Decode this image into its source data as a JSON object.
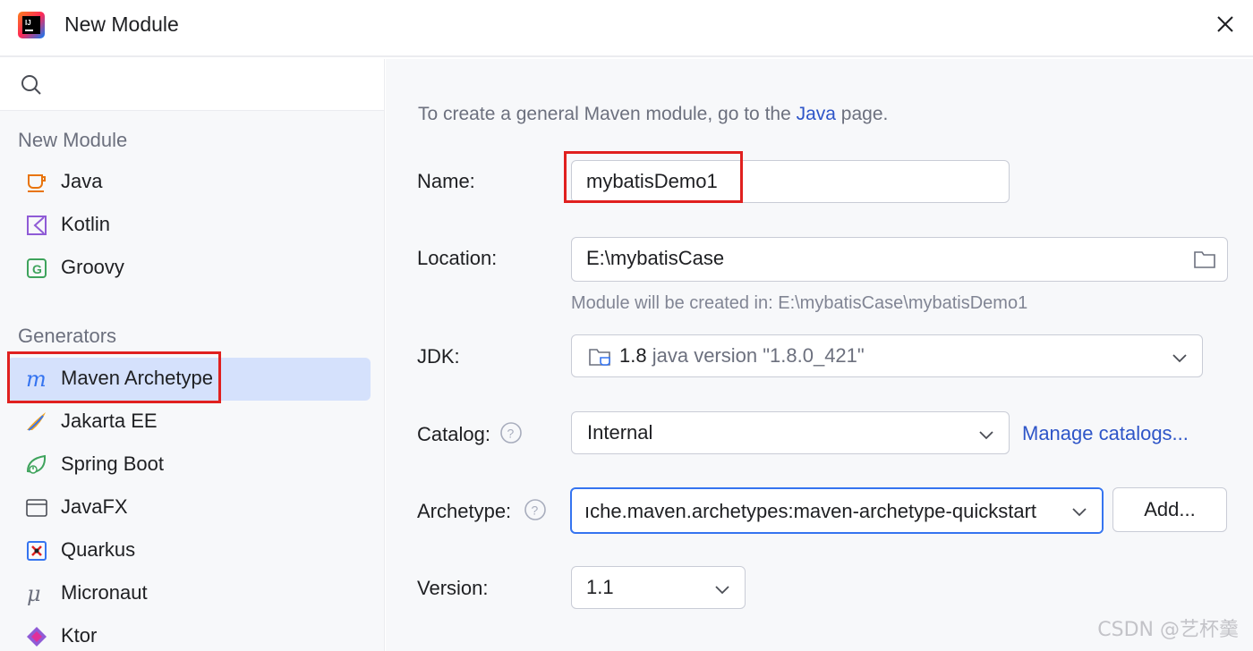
{
  "window": {
    "title": "New Module",
    "logo_icon": "intellij-logo-icon",
    "close_icon": "close-icon"
  },
  "sidebar": {
    "search_icon": "search-icon",
    "sections": [
      {
        "header": "New Module",
        "items": [
          {
            "label": "Java",
            "icon": "java-cup-icon"
          },
          {
            "label": "Kotlin",
            "icon": "kotlin-icon"
          },
          {
            "label": "Groovy",
            "icon": "groovy-icon"
          }
        ]
      },
      {
        "header": "Generators",
        "items": [
          {
            "label": "Maven Archetype",
            "icon": "maven-icon",
            "selected": true
          },
          {
            "label": "Jakarta EE",
            "icon": "jakarta-ee-icon"
          },
          {
            "label": "Spring Boot",
            "icon": "spring-boot-icon"
          },
          {
            "label": "JavaFX",
            "icon": "javafx-icon"
          },
          {
            "label": "Quarkus",
            "icon": "quarkus-icon"
          },
          {
            "label": "Micronaut",
            "icon": "micronaut-icon"
          },
          {
            "label": "Ktor",
            "icon": "ktor-icon"
          }
        ]
      }
    ]
  },
  "main": {
    "hint_prefix": "To create a general Maven module, go to the ",
    "hint_link": "Java",
    "hint_suffix": " page.",
    "name": {
      "label": "Name:",
      "value": "mybatisDemo1"
    },
    "location": {
      "label": "Location:",
      "value": "E:\\mybatisCase",
      "subtext": "Module will be created in: E:\\mybatisCase\\mybatisDemo1"
    },
    "jdk": {
      "label": "JDK:",
      "version": "1.8",
      "detail": "java version \"1.8.0_421\""
    },
    "catalog": {
      "label": "Catalog:",
      "value": "Internal",
      "manage_link": "Manage catalogs..."
    },
    "archetype": {
      "label": "Archetype:",
      "value": "ıche.maven.archetypes:maven-archetype-quickstart",
      "add_button": "Add..."
    },
    "version": {
      "label": "Version:",
      "value": "1.1"
    }
  },
  "watermark": "CSDN @艺杯羹",
  "colors": {
    "accent": "#3574f0",
    "selection": "#d5e1fc",
    "link": "#2e55c8",
    "annotation": "#e0201f"
  }
}
